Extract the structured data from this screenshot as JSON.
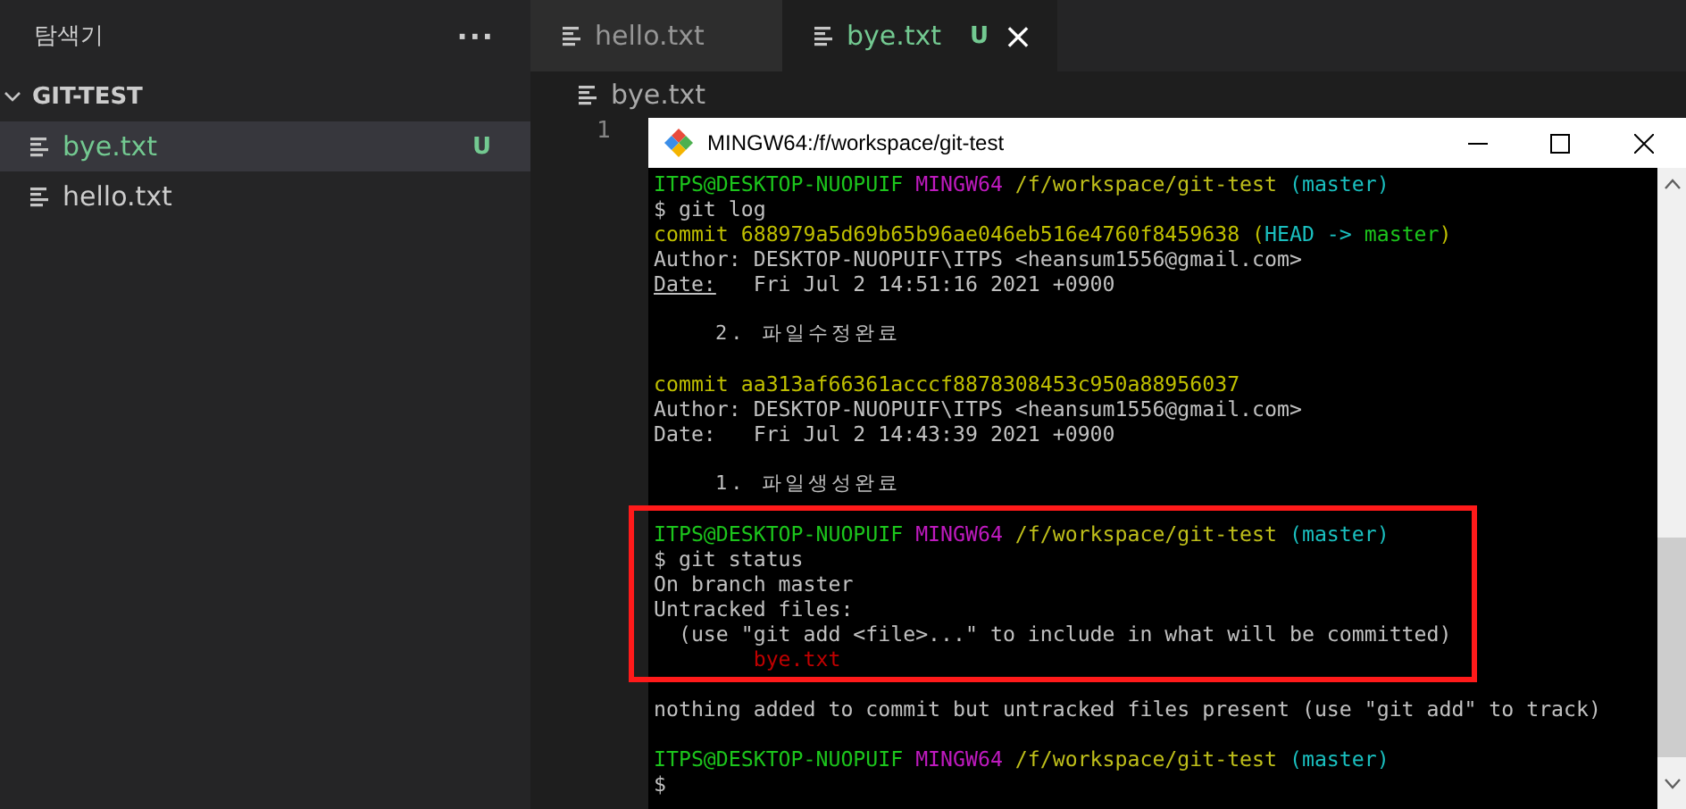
{
  "explorer": {
    "title": "탐색기",
    "more": "···",
    "folder": {
      "name": "GIT-TEST",
      "expanded": true,
      "files": [
        {
          "name": "bye.txt",
          "selected": true,
          "untracked": true,
          "badge": "U"
        },
        {
          "name": "hello.txt",
          "selected": false,
          "untracked": false
        }
      ]
    }
  },
  "tabs": [
    {
      "label": "hello.txt",
      "selected": false,
      "untracked": false
    },
    {
      "label": "bye.txt",
      "selected": true,
      "untracked": true,
      "badge": "U",
      "close": "×"
    }
  ],
  "breadcrumb": "bye.txt",
  "line_numbers": [
    "1"
  ],
  "terminal": {
    "title": "MINGW64:/f/workspace/git-test",
    "sections": [
      {
        "kind": "plain",
        "lines": [
          {
            "kind": "prompt",
            "user": "ITPS@DESKTOP-NUOPUIF",
            "host": "MINGW64",
            "path": "/f/workspace/git-test",
            "branch": "(master)"
          },
          {
            "kind": "text",
            "segments": [
              {
                "text": "$ git log",
                "kind": "plain"
              }
            ]
          },
          {
            "kind": "text",
            "segments": [
              {
                "text": "commit 688979a5d69b65b96ae046eb516e4760f8459638 (",
                "kind": "commit"
              },
              {
                "text": "HEAD -> ",
                "kind": "branch"
              },
              {
                "text": "master",
                "kind": "user"
              },
              {
                "text": ")",
                "kind": "commit"
              }
            ]
          },
          {
            "kind": "text",
            "segments": [
              {
                "text": "Author: DESKTOP-NUOPUIF\\ITPS <heansum1556@gmail.com>",
                "kind": "plain"
              }
            ]
          },
          {
            "kind": "text",
            "segments": [
              {
                "text": "Date:",
                "kind": "underlined"
              },
              {
                "text": "   Fri Jul 2 14:51:16 2021 +0900",
                "kind": "plain"
              }
            ]
          },
          {
            "kind": "blank"
          },
          {
            "kind": "text",
            "segments": [
              {
                "text": "    2. 파일수정완료",
                "kind": "wide"
              }
            ]
          },
          {
            "kind": "blank"
          },
          {
            "kind": "text",
            "segments": [
              {
                "text": "commit aa313af66361acccf8878308453c950a88956037",
                "kind": "commit"
              }
            ]
          },
          {
            "kind": "text",
            "segments": [
              {
                "text": "Author: DESKTOP-NUOPUIF\\ITPS <heansum1556@gmail.com>",
                "kind": "plain"
              }
            ]
          },
          {
            "kind": "text",
            "segments": [
              {
                "text": "Date:   Fri Jul 2 14:43:39 2021 +0900",
                "kind": "plain"
              }
            ]
          },
          {
            "kind": "blank"
          },
          {
            "kind": "text",
            "segments": [
              {
                "text": "    1. 파일생성완료",
                "kind": "wide"
              }
            ]
          },
          {
            "kind": "blank"
          }
        ]
      },
      {
        "kind": "highlighted",
        "lines": [
          {
            "kind": "prompt",
            "user": "ITPS@DESKTOP-NUOPUIF",
            "host": "MINGW64",
            "path": "/f/workspace/git-test",
            "branch": "(master)"
          },
          {
            "kind": "text",
            "segments": [
              {
                "text": "$ git status",
                "kind": "plain"
              }
            ]
          },
          {
            "kind": "text",
            "segments": [
              {
                "text": "On branch master",
                "kind": "plain"
              }
            ]
          },
          {
            "kind": "text",
            "segments": [
              {
                "text": "Untracked files:",
                "kind": "plain"
              }
            ]
          },
          {
            "kind": "text",
            "segments": [
              {
                "text": "  (use \"git add <file>...\" to include in what will be committed)",
                "kind": "plain"
              }
            ]
          },
          {
            "kind": "text",
            "segments": [
              {
                "text": "        bye.txt",
                "kind": "untracked"
              }
            ]
          }
        ]
      },
      {
        "kind": "plain",
        "lines": [
          {
            "kind": "blank"
          },
          {
            "kind": "text",
            "segments": [
              {
                "text": "nothing added to commit but untracked files present (use \"git add\" to track)",
                "kind": "plain"
              }
            ]
          },
          {
            "kind": "blank"
          },
          {
            "kind": "prompt",
            "user": "ITPS@DESKTOP-NUOPUIF",
            "host": "MINGW64",
            "path": "/f/workspace/git-test",
            "branch": "(master)"
          },
          {
            "kind": "text",
            "segments": [
              {
                "text": "$",
                "kind": "plain"
              }
            ]
          }
        ]
      }
    ]
  }
}
